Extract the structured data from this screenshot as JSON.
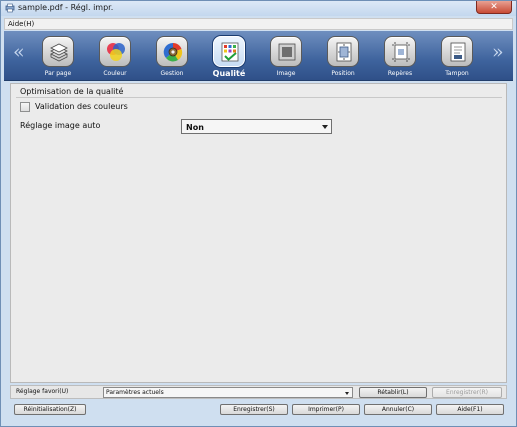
{
  "window": {
    "title": "sample.pdf - Régl. impr.",
    "close_label": "✕"
  },
  "menu": {
    "help": "Aide(H)"
  },
  "toolbar": {
    "left_arrow": "«",
    "right_arrow": "»",
    "items": [
      {
        "label": "Par page",
        "icon": "stack-paper-icon"
      },
      {
        "label": "Couleur",
        "icon": "color-circles-icon"
      },
      {
        "label": "Gestion",
        "icon": "color-wheel-gear-icon"
      },
      {
        "label": "Qualité",
        "icon": "quality-grid-check-icon",
        "active": true
      },
      {
        "label": "Image",
        "icon": "image-square-icon"
      },
      {
        "label": "Position",
        "icon": "position-page-icon"
      },
      {
        "label": "Repères",
        "icon": "crop-marks-icon"
      },
      {
        "label": "Tampon",
        "icon": "stamp-page-icon"
      }
    ]
  },
  "content": {
    "group_title": "Optimisation de la qualité",
    "validation_label": "Validation des couleurs",
    "validation_checked": false,
    "auto_label": "Réglage image auto",
    "auto_value": "Non"
  },
  "favorites": {
    "label": "Réglage favori(U)",
    "value": "Paramètres actuels",
    "restore_label": "Rétablir(L)",
    "register_label": "Enregistrer(R)"
  },
  "bottom": {
    "reset_label": "Réinitialisation(Z)",
    "save_label": "Enregistrer(S)",
    "print_label": "Imprimer(P)",
    "cancel_label": "Annuler(C)",
    "help_label": "Aide(F1)"
  },
  "colors": {
    "toolbar_top": "#6f8fbf",
    "toolbar_bottom": "#2f5088",
    "window_bg": "#cfdff0",
    "panel_bg": "#ebebeb",
    "close_red": "#c84a34"
  }
}
